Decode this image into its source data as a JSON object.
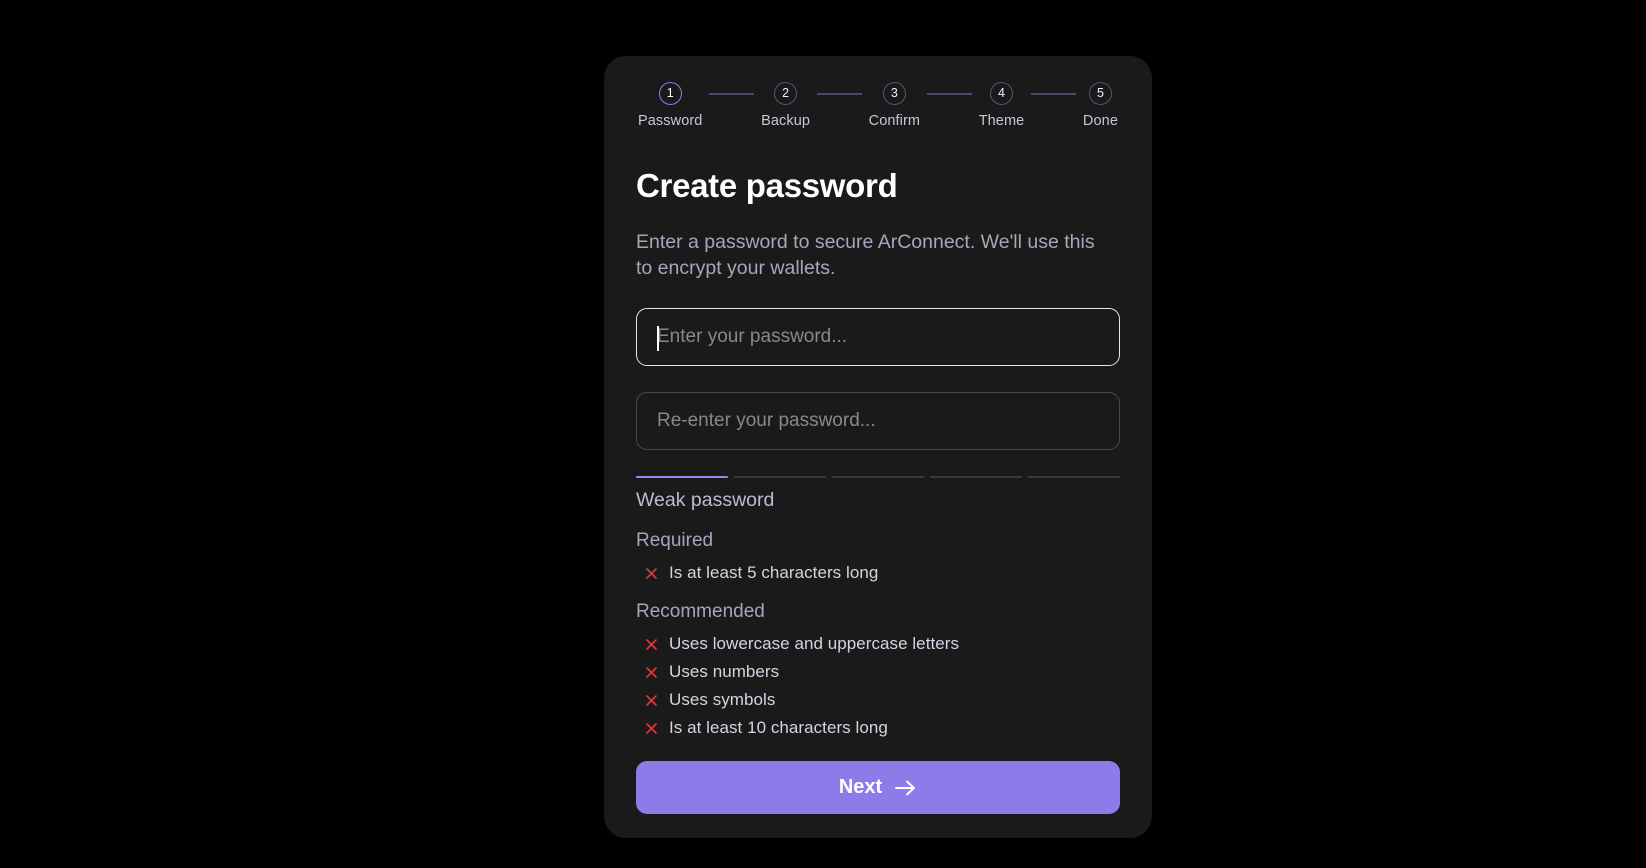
{
  "colors": {
    "page_background": "#000000",
    "card_background": "#1A1A1A",
    "accent_purple": "#8E7BEA",
    "strength_fill": "#9B8AEE",
    "step_active_border": "#8E7BE8",
    "step_inactive_border": "#5B5277",
    "error_red": "#D93A3A",
    "focused_border": "#E6E6E6"
  },
  "stepper": {
    "steps": [
      {
        "number": "1",
        "label": "Password",
        "state": "active"
      },
      {
        "number": "2",
        "label": "Backup",
        "state": "inactive"
      },
      {
        "number": "3",
        "label": "Confirm",
        "state": "inactive"
      },
      {
        "number": "4",
        "label": "Theme",
        "state": "inactive"
      },
      {
        "number": "5",
        "label": "Done",
        "state": "inactive"
      }
    ]
  },
  "main": {
    "title": "Create password",
    "description": "Enter a password to secure ArConnect. We'll use this to encrypt your wallets."
  },
  "password_field": {
    "placeholder": "Enter your password...",
    "value": "",
    "focused": true
  },
  "confirm_field": {
    "placeholder": "Re-enter your password...",
    "value": "",
    "focused": false
  },
  "strength": {
    "label": "Weak password",
    "segments_total": 5,
    "segments_filled": 1
  },
  "requirements": {
    "required": {
      "heading": "Required",
      "items": [
        {
          "text": "Is at least 5 characters long",
          "met": false,
          "icon": "x-icon"
        }
      ]
    },
    "recommended": {
      "heading": "Recommended",
      "items": [
        {
          "text": "Uses lowercase and uppercase letters",
          "met": false,
          "icon": "x-icon"
        },
        {
          "text": "Uses numbers",
          "met": false,
          "icon": "x-icon"
        },
        {
          "text": "Uses symbols",
          "met": false,
          "icon": "x-icon"
        },
        {
          "text": "Is at least 10 characters long",
          "met": false,
          "icon": "x-icon"
        }
      ]
    }
  },
  "next_button": {
    "label": "Next",
    "icon": "arrow-right-icon"
  }
}
